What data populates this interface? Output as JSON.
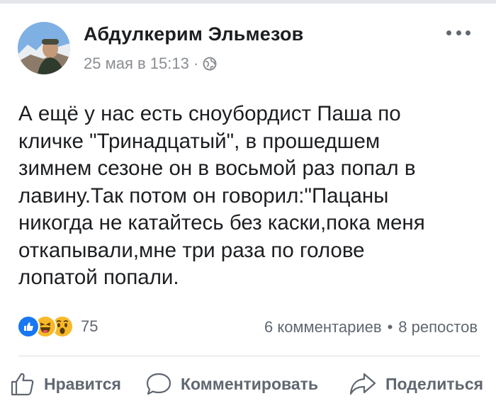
{
  "post": {
    "author": "Абдулкерим Эльмезов",
    "timestamp": "25 мая в 15:13",
    "meta_separator": "·",
    "privacy_icon": "globe-icon",
    "more_icon": "more-options-icon",
    "text": "А ещё у нас есть сноубордист Паша по\nкличке \"Тринадцатый\",  в прошедшем\nзимнем сезоне он в восьмой раз попал в\nлавину.Так потом он говорил:\"Пацаны\nникогда не катайтесь без каски,пока меня\nоткапывали,мне три раза по голове\nлопатой попали."
  },
  "stats": {
    "reaction_icons": [
      "like-icon",
      "haha-icon",
      "wow-icon"
    ],
    "reaction_count": "75",
    "comments": "6 комментариев",
    "separator": "•",
    "shares": "8 репостов"
  },
  "actions": {
    "like_label": "Нравится",
    "comment_label": "Комментировать",
    "share_label": "Поделиться"
  },
  "colors": {
    "like_blue": "#1877f2",
    "reaction_yellow": "#f7b928",
    "secondary_text": "#606770"
  }
}
